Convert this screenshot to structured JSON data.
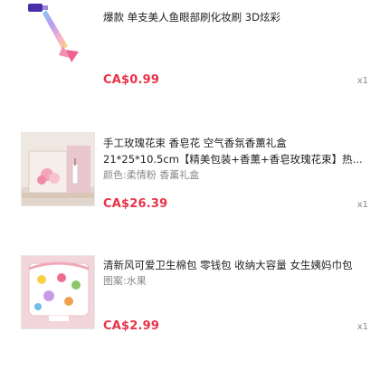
{
  "items": [
    {
      "title": "爆款 单支美人鱼眼部刷化妆刷 3D炫彩",
      "variant": "",
      "price": "CA$0.99",
      "quantity": "x1",
      "thumbnail_icon": "mermaid-makeup-brush-icon"
    },
    {
      "title": "手工玫瑰花束 香皂花 空气香氛香薰礼盒 21*25*10.5cm【精美包装+香薰+香皂玫瑰花束】热...",
      "variant": "颜色:柔情粉 香薰礼盒",
      "price": "CA$26.39",
      "quantity": "x1",
      "thumbnail_icon": "rose-gift-box-icon"
    },
    {
      "title": "清新风可爱卫生棉包 零钱包 收纳大容量 女生姨妈巾包",
      "variant": "图案:水果",
      "price": "CA$2.99",
      "quantity": "x1",
      "thumbnail_icon": "fruit-pouch-icon"
    }
  ]
}
